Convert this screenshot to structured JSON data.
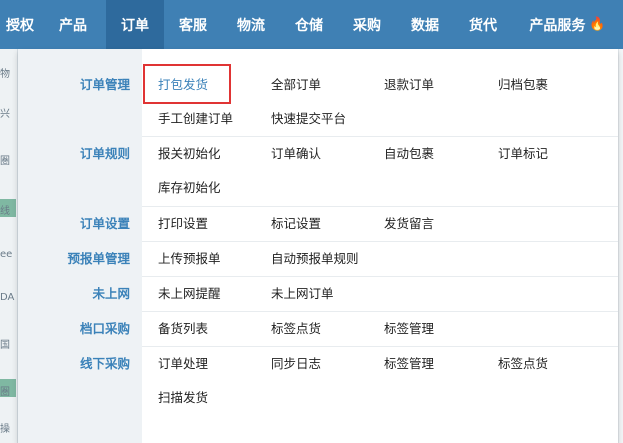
{
  "nav": {
    "items": [
      {
        "label": "授权"
      },
      {
        "label": "产品"
      },
      {
        "label": "订单"
      },
      {
        "label": "客服"
      },
      {
        "label": "物流"
      },
      {
        "label": "仓储"
      },
      {
        "label": "采购"
      },
      {
        "label": "数据"
      },
      {
        "label": "货代"
      },
      {
        "label": "产品服务"
      }
    ],
    "active_index": 2,
    "hot_icon": "flame-icon"
  },
  "background": {
    "left_fragments": [
      "物",
      "兴",
      "圏",
      "线",
      "ee",
      "DA",
      "国",
      "圏",
      "操"
    ]
  },
  "menu": {
    "sections": [
      {
        "label": "订单管理",
        "rows": [
          [
            "打包发货",
            "全部订单",
            "退款订单",
            "归档包裹"
          ],
          [
            "手工创建订单",
            "快速提交平台"
          ]
        ]
      },
      {
        "label": "订单规则",
        "rows": [
          [
            "报关初始化",
            "订单确认",
            "自动包裹",
            "订单标记"
          ],
          [
            "库存初始化"
          ]
        ]
      },
      {
        "label": "订单设置",
        "rows": [
          [
            "打印设置",
            "标记设置",
            "发货留言"
          ]
        ]
      },
      {
        "label": "预报单管理",
        "rows": [
          [
            "上传预报单",
            "自动预报单规则"
          ]
        ]
      },
      {
        "label": "未上网",
        "rows": [
          [
            "未上网提醒",
            "未上网订单"
          ]
        ]
      },
      {
        "label": "档口采购",
        "rows": [
          [
            "备货列表",
            "标签点货",
            "标签管理"
          ]
        ]
      },
      {
        "label": "线下采购",
        "rows": [
          [
            "订单处理",
            "同步日志",
            "标签管理",
            "标签点货"
          ],
          [
            "扫描发货"
          ]
        ]
      }
    ],
    "highlighted_item": "打包发货",
    "colors": {
      "nav_bg": "#3f80b4",
      "nav_active": "#2e6a9d",
      "section_label": "#3b82b9",
      "highlight_border": "#e03434"
    }
  }
}
